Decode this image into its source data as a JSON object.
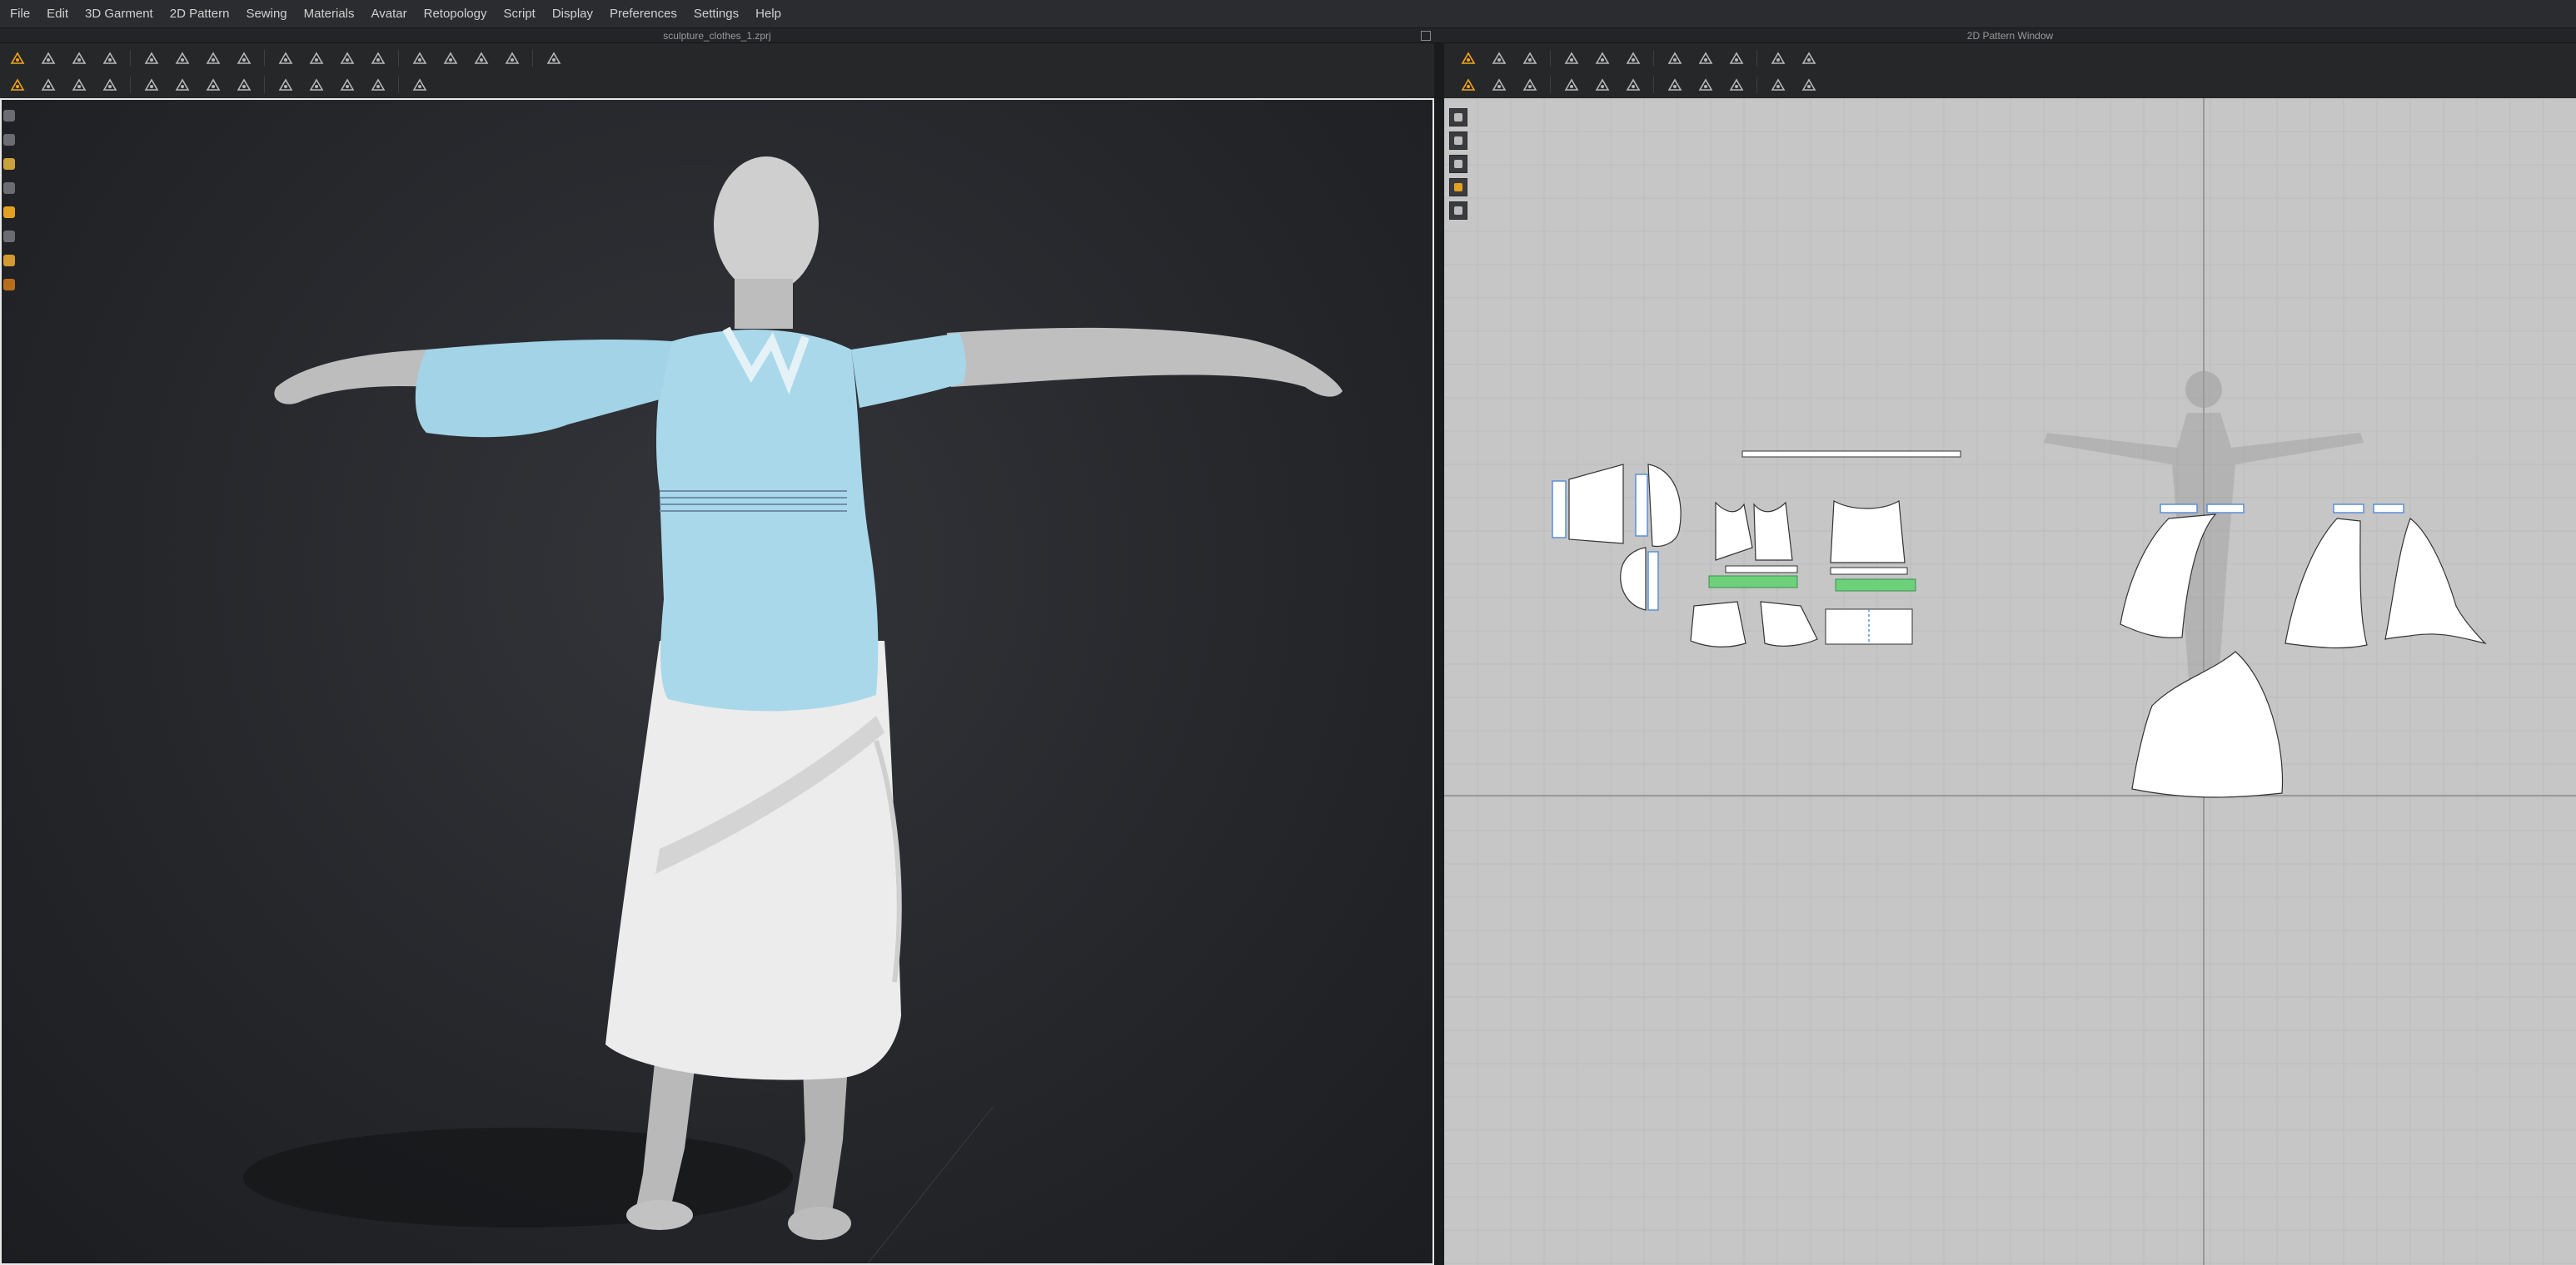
{
  "menu": {
    "items": [
      "File",
      "Edit",
      "3D Garment",
      "2D Pattern",
      "Sewing",
      "Materials",
      "Avatar",
      "Retopology",
      "Script",
      "Display",
      "Preferences",
      "Settings",
      "Help"
    ]
  },
  "window": {
    "title_3d": "sculpture_clothes_1.zprj",
    "title_2d": "2D Pattern Window"
  },
  "toolbar_3d": {
    "row1_icons": [
      "select-move-icon",
      "transform-icon",
      "fold-icon",
      "point-icon",
      "arrange-icon",
      "pin-icon",
      "tack-icon",
      "zipper-icon",
      "button-icon",
      "buttonhole-icon",
      "fitting-icon",
      "avatar-measure-icon",
      "tape-icon",
      "measure-icon",
      "ruler-icon",
      "grid-icon",
      "grid-alt-icon"
    ],
    "row2_icons": [
      "edit-icon",
      "pleat-icon",
      "strengthen-icon",
      "solidify-icon",
      "thread-icon",
      "trace-icon",
      "pattern-icon",
      "circle-icon",
      "fold-arrange-icon",
      "elastic-icon",
      "measure-line-icon",
      "flat-icon",
      "align-icon"
    ]
  },
  "toolbar_2d": {
    "row1_icons": [
      "transform-pattern-icon",
      "edit-point-icon",
      "polygon-icon",
      "rectangle-icon",
      "trace-2d-icon",
      "internal-shape-icon",
      "seam-allowance-icon",
      "bar-icon",
      "segment-sewing-icon",
      "free-sewing-icon",
      "grid-2d-icon"
    ],
    "row2_icons": [
      "edit-curve-icon",
      "curve-point-icon",
      "dart-icon",
      "notch-icon",
      "fold-2d-icon",
      "pleat-2d-icon",
      "puckering-icon",
      "tuck-icon",
      "glue-icon",
      "ruler-2d-icon",
      "dashed-line-icon"
    ]
  },
  "colors": {
    "menubar": "#2b2c2f",
    "viewport_bg": "#25272b",
    "pattern_bg": "#c6c6c6",
    "garment_top": "#a9d8ea",
    "garment_skirt": "#ececec",
    "avatar": "#b9b9b9",
    "accent": "#f2a51a",
    "sewing_green": "#6cd17a",
    "sewing_blue": "#5a8fd8"
  }
}
